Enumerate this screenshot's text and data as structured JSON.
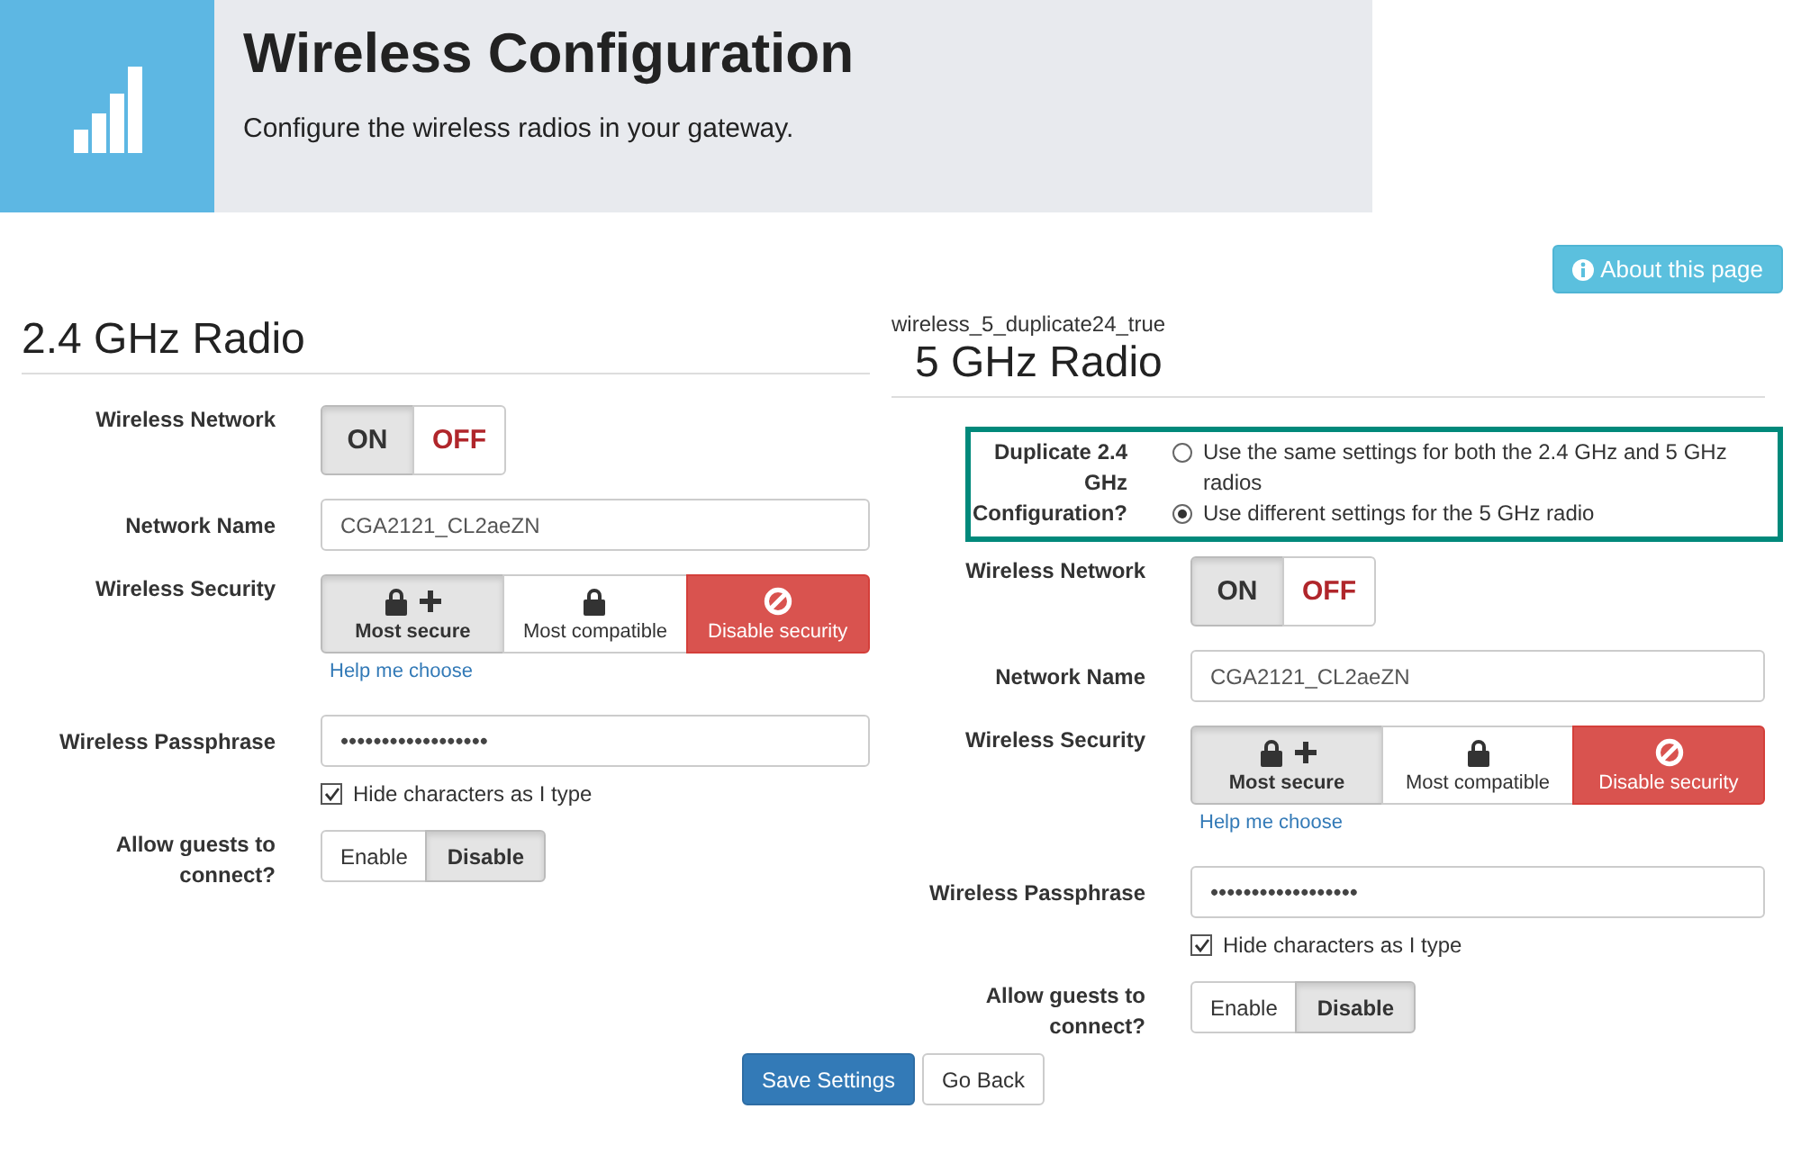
{
  "header": {
    "title": "Wireless Configuration",
    "subtitle": "Configure the wireless radios in your gateway."
  },
  "about_button": "About this page",
  "radios": [
    {
      "title": "2.4 GHz Radio",
      "network": {
        "label": "Wireless Network",
        "options": [
          {
            "label": "ON",
            "kind": "on",
            "selected": true
          },
          {
            "label": "OFF",
            "kind": "off",
            "selected": false
          }
        ]
      },
      "name": {
        "label": "Network Name",
        "value": "CGA2121_CL2aeZN"
      },
      "security": {
        "label": "Wireless Security",
        "options": [
          {
            "label": "Most secure",
            "kind": "strong",
            "selected": true
          },
          {
            "label": "Most compatible",
            "kind": "compatible",
            "selected": false
          },
          {
            "label": "Disable security",
            "kind": "disable",
            "selected": false
          }
        ],
        "help": "Help me choose"
      },
      "passphrase": {
        "label": "Wireless Passphrase",
        "value": "••••••••••••••••••"
      },
      "hide": {
        "label": "Hide characters as I type",
        "checked": true
      },
      "guests": {
        "label": "Allow guests to connect?",
        "options": [
          {
            "label": "Enable",
            "selected": false
          },
          {
            "label": "Disable",
            "selected": true
          }
        ]
      }
    },
    {
      "caption": "wireless_5_duplicate24_true",
      "title": "5 GHz Radio",
      "duplicate": {
        "label": "Duplicate 2.4 GHz Configuration?",
        "options": [
          {
            "label": "Use the same settings for both the 2.4 GHz and 5 GHz radios",
            "selected": false
          },
          {
            "label": "Use different settings for the 5 GHz radio",
            "selected": true
          }
        ]
      },
      "network": {
        "label": "Wireless Network",
        "options": [
          {
            "label": "ON",
            "kind": "on",
            "selected": true
          },
          {
            "label": "OFF",
            "kind": "off",
            "selected": false
          }
        ]
      },
      "name": {
        "label": "Network Name",
        "value": "CGA2121_CL2aeZN"
      },
      "security": {
        "label": "Wireless Security",
        "options": [
          {
            "label": "Most secure",
            "kind": "strong",
            "selected": true
          },
          {
            "label": "Most compatible",
            "kind": "compatible",
            "selected": false
          },
          {
            "label": "Disable security",
            "kind": "disable",
            "selected": false
          }
        ],
        "help": "Help me choose"
      },
      "passphrase": {
        "label": "Wireless Passphrase",
        "value": "••••••••••••••••••"
      },
      "hide": {
        "label": "Hide characters as I type",
        "checked": true
      },
      "guests": {
        "label": "Allow guests to connect?",
        "options": [
          {
            "label": "Enable",
            "selected": false
          },
          {
            "label": "Disable",
            "selected": true
          }
        ]
      }
    }
  ],
  "actions": [
    {
      "label": "Save Settings",
      "kind": "primary"
    },
    {
      "label": "Go Back",
      "kind": "default"
    }
  ]
}
